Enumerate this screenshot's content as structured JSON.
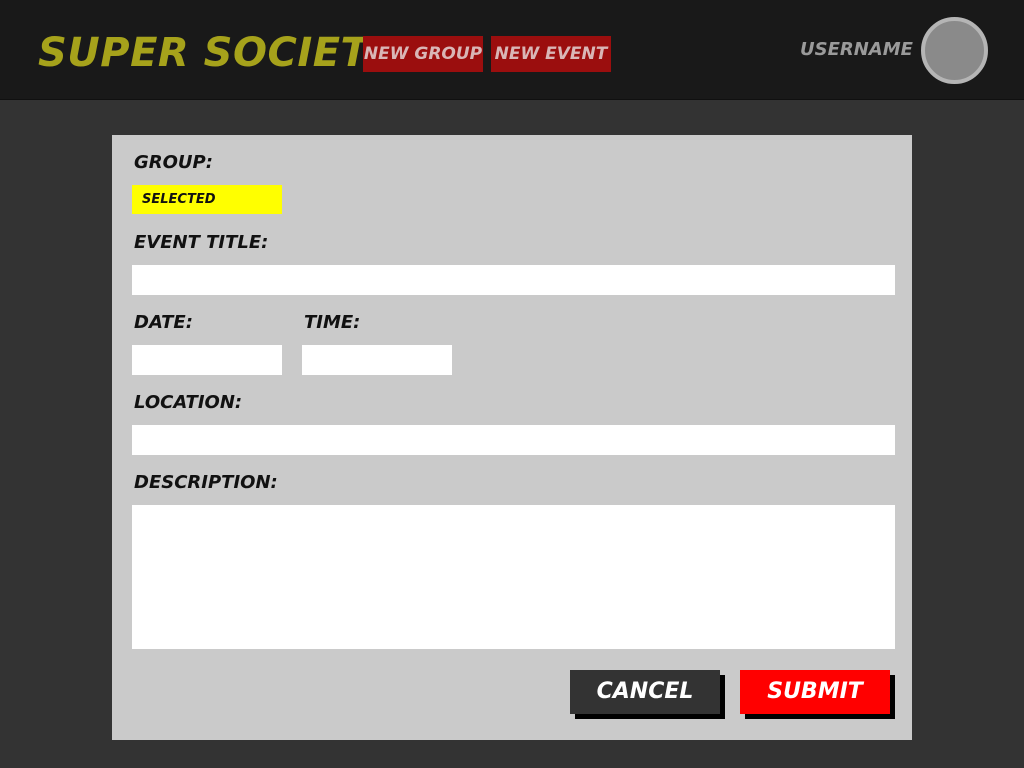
{
  "app": {
    "title": "SUPER SOCIETY"
  },
  "nav": {
    "new_group": "NEW GROUP",
    "new_event": "NEW EVENT"
  },
  "user": {
    "name": "USERNAME"
  },
  "form": {
    "group_label": "GROUP:",
    "group_value": "SELECTED",
    "event_title_label": "EVENT TITLE:",
    "event_title_value": "",
    "date_label": "DATE:",
    "date_value": "",
    "time_label": "TIME:",
    "time_value": "",
    "location_label": "LOCATION:",
    "location_value": "",
    "description_label": "DESCRIPTION:",
    "description_value": "",
    "cancel_label": "CANCEL",
    "submit_label": "SUBMIT"
  },
  "colors": {
    "header_bg": "#191919",
    "page_bg": "#333333",
    "panel_bg": "#cacaca",
    "logo": "#a6a21b",
    "nav_button": "#9b0e0e",
    "selected_highlight": "#ffff00",
    "submit": "#ff0000",
    "cancel": "#333333"
  }
}
